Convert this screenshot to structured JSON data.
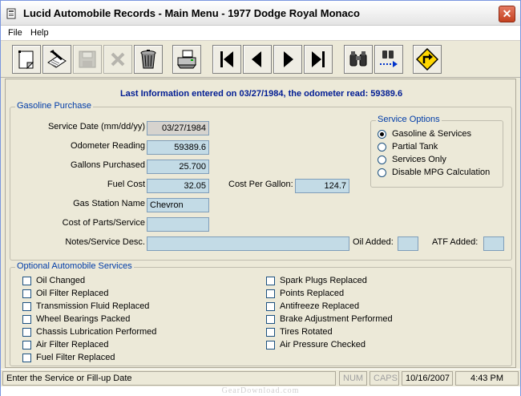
{
  "window": {
    "title": "Lucid Automobile Records - Main Menu - 1977 Dodge Royal Monaco",
    "close_glyph": "✕"
  },
  "menu": [
    "File",
    "Help"
  ],
  "toolbar": {
    "buttons": [
      {
        "icon": "new-document-icon",
        "enabled": true
      },
      {
        "icon": "edit-pen-icon",
        "enabled": true
      },
      {
        "icon": "save-disk-icon",
        "enabled": false
      },
      {
        "icon": "delete-x-icon",
        "enabled": false
      },
      {
        "icon": "trash-can-icon",
        "enabled": true
      },
      {
        "icon": "printer-icon",
        "enabled": true
      },
      {
        "icon": "first-record-icon",
        "enabled": true
      },
      {
        "icon": "previous-record-icon",
        "enabled": true
      },
      {
        "icon": "next-record-icon",
        "enabled": true
      },
      {
        "icon": "last-record-icon",
        "enabled": true
      },
      {
        "icon": "find-binoculars-icon",
        "enabled": true
      },
      {
        "icon": "find-next-icon",
        "enabled": true
      },
      {
        "icon": "road-sign-icon",
        "enabled": true
      }
    ]
  },
  "last_info": "Last Information entered on 03/27/1984, the odometer read: 59389.6",
  "gasoline": {
    "legend": "Gasoline Purchase",
    "service_date_label": "Service Date (mm/dd/yy)",
    "service_date": "03/27/1984",
    "odometer_label": "Odometer Reading",
    "odometer": "59389.6",
    "gallons_label": "Gallons Purchased",
    "gallons": "25.700",
    "fuel_cost_label": "Fuel Cost",
    "fuel_cost": "32.05",
    "cost_per_gallon_label": "Cost Per Gallon:",
    "cost_per_gallon": "124.7",
    "station_label": "Gas Station Name",
    "station": "Chevron",
    "parts_label": "Cost of Parts/Service",
    "parts": "",
    "notes_label": "Notes/Service Desc.",
    "notes": "",
    "oil_added_label": "Oil Added:",
    "oil_added": "",
    "atf_added_label": "ATF Added:",
    "atf_added": ""
  },
  "service_options": {
    "legend": "Service Options",
    "options": [
      "Gasoline & Services",
      "Partial Tank",
      "Services Only",
      "Disable MPG Calculation"
    ],
    "selected": 0
  },
  "optional": {
    "legend": "Optional Automobile Services",
    "left": [
      "Oil Changed",
      "Oil Filter Replaced",
      "Transmission Fluid Replaced",
      "Wheel Bearings Packed",
      "Chassis Lubrication Performed",
      "Air Filter Replaced",
      "Fuel Filter Replaced"
    ],
    "right": [
      "Spark Plugs Replaced",
      "Points Replaced",
      "Antifreeze Replaced",
      "Brake Adjustment Performed",
      "Tires Rotated",
      "Air Pressure Checked"
    ]
  },
  "status": {
    "message": "Enter the Service or Fill-up Date",
    "num": "NUM",
    "caps": "CAPS",
    "date": "10/16/2007",
    "time": "4:43 PM"
  },
  "watermark": "GearDownload.com"
}
